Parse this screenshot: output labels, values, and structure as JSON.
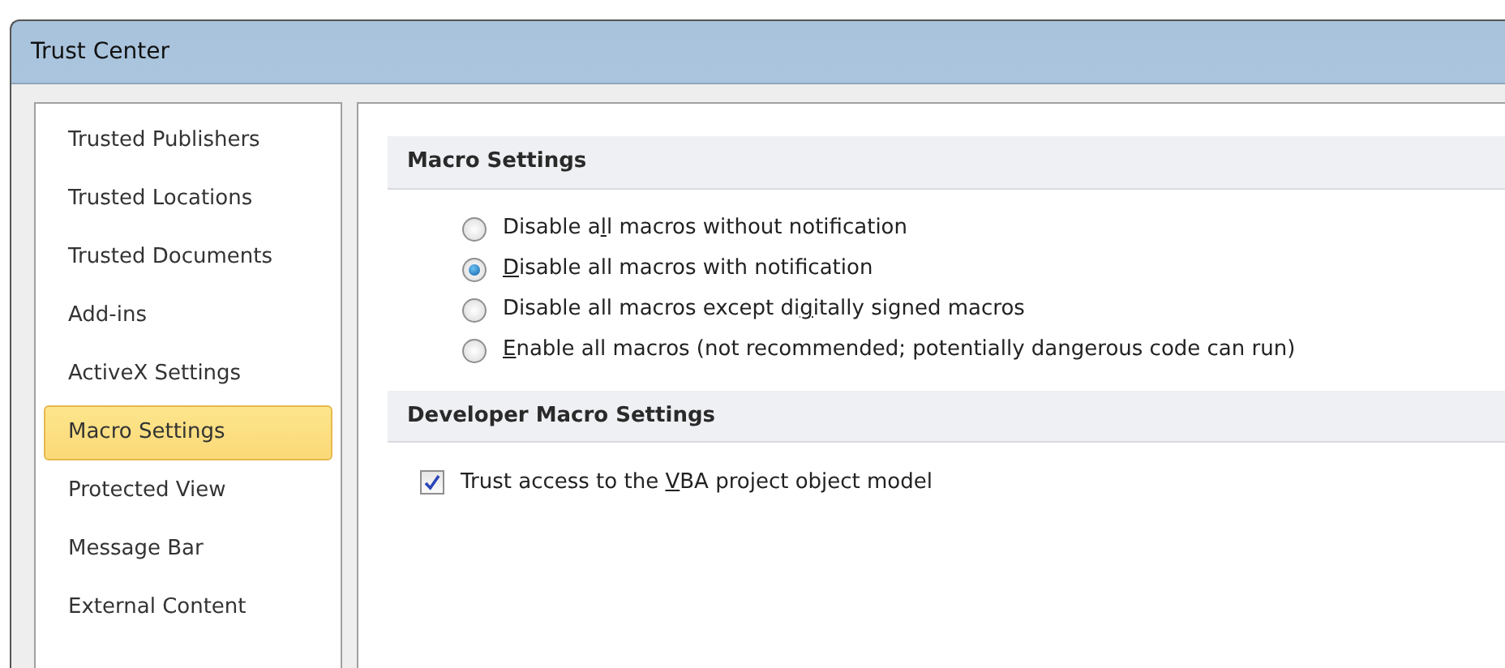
{
  "window": {
    "title": "Trust Center"
  },
  "sidebar": {
    "items": [
      {
        "label": "Trusted Publishers",
        "selected": false
      },
      {
        "label": "Trusted Locations",
        "selected": false
      },
      {
        "label": "Trusted Documents",
        "selected": false
      },
      {
        "label": "Add-ins",
        "selected": false
      },
      {
        "label": "ActiveX Settings",
        "selected": false
      },
      {
        "label": "Macro Settings",
        "selected": true
      },
      {
        "label": "Protected View",
        "selected": false
      },
      {
        "label": "Message Bar",
        "selected": false
      },
      {
        "label": "External Content",
        "selected": false
      }
    ]
  },
  "sections": [
    {
      "heading": "Macro Settings",
      "options": [
        {
          "kind": "radio",
          "before": "Disable a",
          "access_key": "l",
          "after": "l macros without notification",
          "selected": false
        },
        {
          "kind": "radio",
          "access_key": "D",
          "after": "isable all macros with notification",
          "selected": true
        },
        {
          "kind": "radio",
          "before": "Disable all macros except di",
          "access_key": "g",
          "after": "itally signed macros",
          "selected": false
        },
        {
          "kind": "radio",
          "access_key": "E",
          "after": "nable all macros (not recommended; potentially dangerous code can run)",
          "selected": false
        }
      ]
    },
    {
      "heading": "Developer Macro Settings",
      "options": [
        {
          "kind": "checkbox",
          "before": "Trust access to the ",
          "access_key": "V",
          "after": "BA project object model",
          "checked": true
        }
      ]
    }
  ]
}
